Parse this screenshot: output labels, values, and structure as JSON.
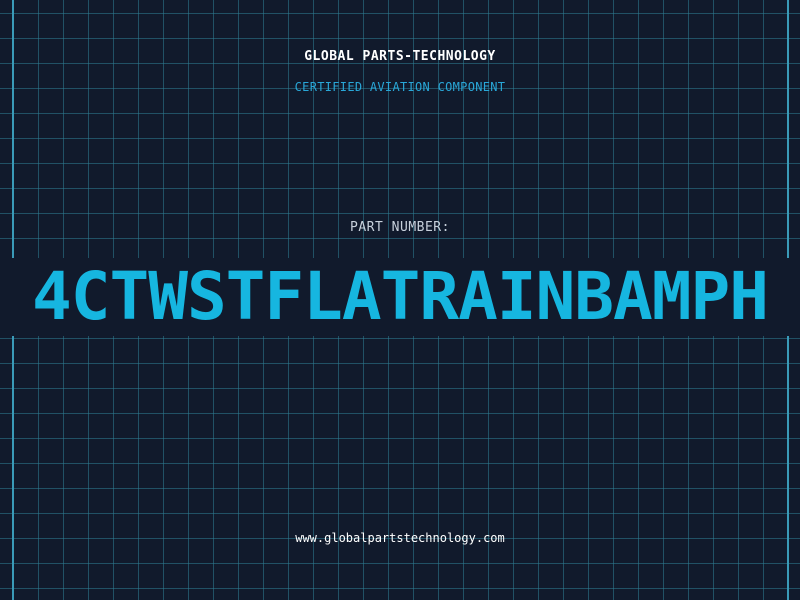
{
  "header": {
    "company": "GLOBAL PARTS-TECHNOLOGY",
    "tagline": "CERTIFIED AVIATION COMPONENT"
  },
  "part": {
    "label": "PART NUMBER:",
    "number": "4CTWSTFLATRAINBAMPH"
  },
  "footer": {
    "website": "www.globalpartstechnology.com"
  },
  "colors": {
    "background": "#111a2c",
    "grid": "#2e7e94",
    "accent": "#16b6e0",
    "text": "#ffffff"
  }
}
